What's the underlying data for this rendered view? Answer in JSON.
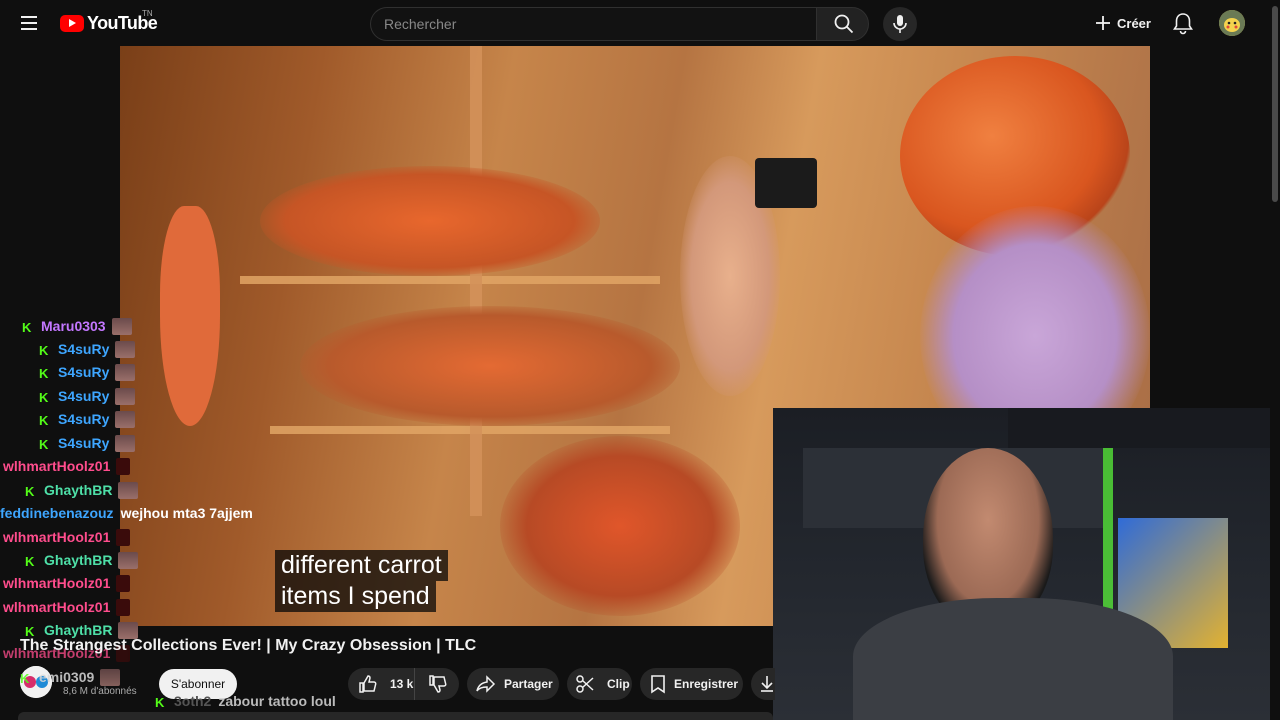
{
  "header": {
    "logo_text": "YouTube",
    "logo_country": "TN",
    "search_placeholder": "Rechercher",
    "create_label": "Créer"
  },
  "video": {
    "caption_line1": "different carrot",
    "caption_line2": "items I spend"
  },
  "chat": {
    "messages": [
      {
        "user": "Maru0303",
        "color": "#c377ff",
        "badge": true,
        "message": ""
      },
      {
        "user": "S4suRy",
        "color": "#3ea6ff",
        "badge": true,
        "message": ""
      },
      {
        "user": "S4suRy",
        "color": "#3ea6ff",
        "badge": true,
        "message": ""
      },
      {
        "user": "S4suRy",
        "color": "#3ea6ff",
        "badge": true,
        "message": ""
      },
      {
        "user": "S4suRy",
        "color": "#3ea6ff",
        "badge": true,
        "message": ""
      },
      {
        "user": "S4suRy",
        "color": "#3ea6ff",
        "badge": true,
        "message": ""
      },
      {
        "user": "wlhmartHoolz01",
        "color": "#ff4d8d",
        "badge": false,
        "message": ""
      },
      {
        "user": "GhaythBR",
        "color": "#4ee0a8",
        "badge": true,
        "message": ""
      },
      {
        "user": "feddinebenazouz",
        "color": "#3ea6ff",
        "badge": false,
        "message": "wejhou mta3 7ajjem"
      },
      {
        "user": "wlhmartHoolz01",
        "color": "#ff4d8d",
        "badge": false,
        "message": ""
      },
      {
        "user": "GhaythBR",
        "color": "#4ee0a8",
        "badge": true,
        "message": ""
      },
      {
        "user": "wlhmartHoolz01",
        "color": "#ff4d8d",
        "badge": false,
        "message": ""
      },
      {
        "user": "wlhmartHoolz01",
        "color": "#ff4d8d",
        "badge": false,
        "message": ""
      },
      {
        "user": "GhaythBR",
        "color": "#4ee0a8",
        "badge": true,
        "message": ""
      },
      {
        "user": "wlhmartHoolz01",
        "color": "#ff4d8d",
        "badge": false,
        "message": ""
      },
      {
        "user": "emi0309",
        "color": "#9aa0a6",
        "badge": true,
        "message": ""
      },
      {
        "user": "3oth2",
        "color": "#555555",
        "badge": true,
        "message": "zabour tattoo loul"
      }
    ]
  },
  "video_info": {
    "title": "The Strangest Collections Ever! | My Crazy Obsession | TLC",
    "channel_subscribers": "8,6 M d'abonnés",
    "subscribe_label": "S'abonner",
    "like_count": "13 k",
    "share_label": "Partager",
    "clip_label": "Clip",
    "save_label": "Enregistrer"
  },
  "icons": {
    "menu": "hamburger-icon",
    "search": "search-icon",
    "mic": "microphone-icon",
    "create": "plus-icon",
    "notifications": "bell-icon",
    "like": "thumbs-up-icon",
    "dislike": "thumbs-down-icon",
    "share": "share-arrow-icon",
    "clip": "scissors-icon",
    "save": "bookmark-icon",
    "download": "download-icon"
  },
  "colors": {
    "background": "#0f0f0f",
    "brand_red": "#ff0000",
    "kick_green": "#53fc18"
  }
}
